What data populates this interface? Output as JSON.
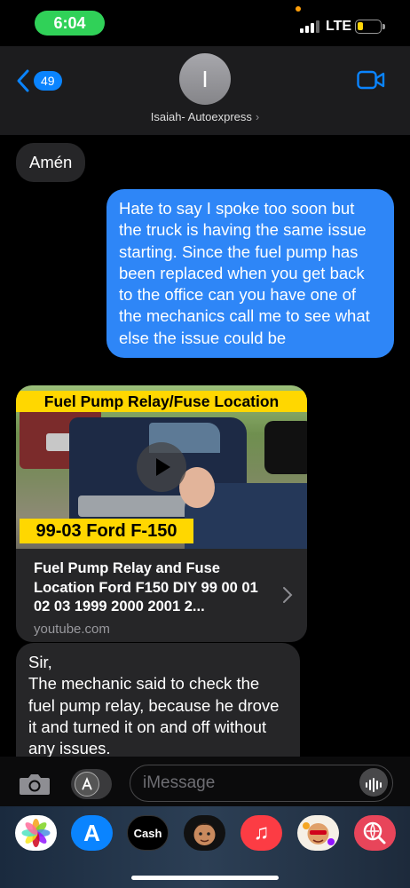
{
  "status_bar": {
    "time": "6:04",
    "network": "LTE",
    "signal_bars": 3,
    "battery_level": 0.2,
    "colors": {
      "time_pill": "#30d158",
      "battery": "#ffd60a"
    }
  },
  "header": {
    "back_count": "49",
    "avatar_initial": "I",
    "contact_name": "Isaiah- Autoexpress",
    "contact_chevron": "›",
    "icons": [
      "back-chevron-icon",
      "video-call-icon"
    ]
  },
  "messages": [
    {
      "direction": "incoming",
      "text": "Amén"
    },
    {
      "direction": "outgoing",
      "text": "Hate to say I spoke too soon but the truck is having the same issue starting. Since the fuel pump has been replaced when you get back to the office can you have one of the mechanics call me to see what else the issue could be"
    },
    {
      "direction": "incoming",
      "type": "link",
      "thumbnail_title": "Fuel Pump Relay/Fuse Location",
      "thumbnail_subtitle": "99-03 Ford F-150",
      "title": "Fuel Pump Relay and Fuse Location Ford F150 DIY 99 00 01 02 03 1999 2000 2001 2...",
      "domain": "youtube.com"
    },
    {
      "direction": "incoming",
      "text": "Sir,\nThe mechanic said to check the fuel pump relay, because he drove it and turned it on and off without any issues."
    }
  ],
  "input": {
    "placeholder": "iMessage",
    "icons": [
      "camera-icon",
      "app-store-apps-icon",
      "audio-waveform-icon"
    ]
  },
  "app_drawer": {
    "apps": [
      {
        "name": "photos-icon"
      },
      {
        "name": "app-store-icon",
        "glyph": "A"
      },
      {
        "name": "cash-app-icon",
        "label": "Cash"
      },
      {
        "name": "memoji-icon"
      },
      {
        "name": "music-icon",
        "glyph": "♫"
      },
      {
        "name": "memoji-stickers-icon"
      },
      {
        "name": "web-search-icon"
      }
    ]
  },
  "colors": {
    "outgoing_bubble": "#2e86f7",
    "incoming_bubble": "#262628",
    "accent": "#0a84ff"
  }
}
